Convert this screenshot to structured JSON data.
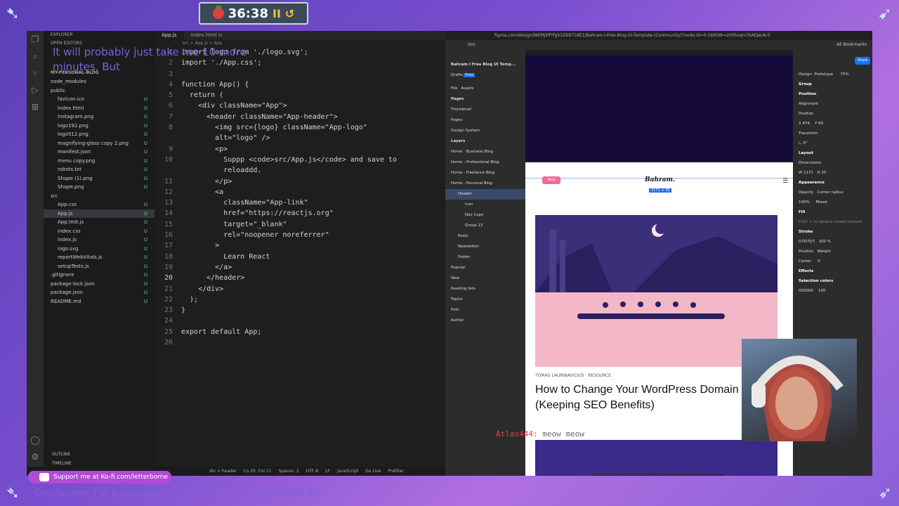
{
  "timer": {
    "time": "36:38",
    "pause": "II",
    "reset": "↺"
  },
  "overlay_text": "It will probably just take me 10 more minutes. But",
  "vscode": {
    "explorer_title": "EXPLORER",
    "open_editors": "OPEN EDITORS",
    "project": "MY-PERSONAL-BLOG",
    "tree": [
      {
        "label": "node_modules",
        "indent": 1,
        "badge": ""
      },
      {
        "label": "public",
        "indent": 1,
        "badge": ""
      },
      {
        "label": "favicon.ico",
        "indent": 2,
        "badge": "U"
      },
      {
        "label": "index.html",
        "indent": 2,
        "badge": "U"
      },
      {
        "label": "Instagram.png",
        "indent": 2,
        "badge": "U"
      },
      {
        "label": "logo192.png",
        "indent": 2,
        "badge": "U"
      },
      {
        "label": "logo512.png",
        "indent": 2,
        "badge": "U"
      },
      {
        "label": "magnifying-glass copy 2.png",
        "indent": 2,
        "badge": "U"
      },
      {
        "label": "manifest.json",
        "indent": 2,
        "badge": "U"
      },
      {
        "label": "menu copy.png",
        "indent": 2,
        "badge": "U"
      },
      {
        "label": "robots.txt",
        "indent": 2,
        "badge": "U"
      },
      {
        "label": "Shape (1).png",
        "indent": 2,
        "badge": "U"
      },
      {
        "label": "Shape.png",
        "indent": 2,
        "badge": "U"
      },
      {
        "label": "src",
        "indent": 1,
        "badge": ""
      },
      {
        "label": "App.css",
        "indent": 2,
        "badge": "U"
      },
      {
        "label": "App.js",
        "indent": 2,
        "badge": "U"
      },
      {
        "label": "App.test.js",
        "indent": 2,
        "badge": "U"
      },
      {
        "label": "index.css",
        "indent": 2,
        "badge": "U"
      },
      {
        "label": "index.js",
        "indent": 2,
        "badge": "U"
      },
      {
        "label": "logo.svg",
        "indent": 2,
        "badge": "U"
      },
      {
        "label": "reportWebVitals.js",
        "indent": 2,
        "badge": "U"
      },
      {
        "label": "setupTests.js",
        "indent": 2,
        "badge": "U"
      },
      {
        "label": ".gitignore",
        "indent": 1,
        "badge": "U"
      },
      {
        "label": "package-lock.json",
        "indent": 1,
        "badge": "U"
      },
      {
        "label": "package.json",
        "indent": 1,
        "badge": "U"
      },
      {
        "label": "README.md",
        "indent": 1,
        "badge": "U"
      }
    ],
    "outline": "OUTLINE",
    "timeline": "TIMELINE",
    "tabs": [
      "App.js",
      "index.html U"
    ],
    "breadcrumb": "src > App.js > App",
    "code": [
      {
        "n": "1",
        "t": "import logo from './logo.svg';"
      },
      {
        "n": "2",
        "t": "import './App.css';"
      },
      {
        "n": "3",
        "t": ""
      },
      {
        "n": "4",
        "t": "function App() {"
      },
      {
        "n": "5",
        "t": "  return ("
      },
      {
        "n": "6",
        "t": "    <div className=\"App\">"
      },
      {
        "n": "7",
        "t": "      <header className=\"App-header\">"
      },
      {
        "n": "8",
        "t": "        <img src={logo} className=\"App-logo\""
      },
      {
        "n": "",
        "t": "        alt=\"logo\" />"
      },
      {
        "n": "9",
        "t": "        <p>"
      },
      {
        "n": "10",
        "t": "          Suppp <code>src/App.js</code> and save to"
      },
      {
        "n": "",
        "t": "          reloaddd."
      },
      {
        "n": "11",
        "t": "        </p>"
      },
      {
        "n": "12",
        "t": "        <a"
      },
      {
        "n": "13",
        "t": "          className=\"App-link\""
      },
      {
        "n": "14",
        "t": "          href=\"https://reactjs.org\""
      },
      {
        "n": "15",
        "t": "          target=\"_blank\""
      },
      {
        "n": "16",
        "t": "          rel=\"noopener noreferrer\""
      },
      {
        "n": "17",
        "t": "        >"
      },
      {
        "n": "18",
        "t": "          Learn React"
      },
      {
        "n": "19",
        "t": "        </a>"
      },
      {
        "n": "20",
        "t": "      </header>"
      },
      {
        "n": "21",
        "t": "    </div>"
      },
      {
        "n": "22",
        "t": "  );"
      },
      {
        "n": "23",
        "t": "}"
      },
      {
        "n": "24",
        "t": ""
      },
      {
        "n": "25",
        "t": "export default App;"
      },
      {
        "n": "26",
        "t": ""
      }
    ],
    "status": [
      "div > header",
      "Ln 20, Col 11",
      "Spaces: 2",
      "UTF-8",
      "LF",
      "JavaScript",
      "Go Live",
      "Prettier"
    ]
  },
  "browser": {
    "url": "figma.com/design/WEMjl0fYfgV2Z68716E1/Bahram-I-Free-Blog-UI-Template-(Community)?node-id=0-16658t=zHShsqm7kAEJecN-0",
    "bookmark": "Uni",
    "all_bookmarks": "All Bookmarks",
    "file_title": "Bahram I Free Blog UI Temp...",
    "drafts": "Drafts",
    "free": "Free",
    "file_tab": "File",
    "assets_tab": "Assets",
    "pages_label": "Pages",
    "pages": [
      "Thumbnail",
      "Pages",
      "Design System"
    ],
    "layers_label": "Layers",
    "layers": [
      {
        "label": "Home - Business Blog",
        "indent": 0
      },
      {
        "label": "Home - Professional Blog",
        "indent": 0
      },
      {
        "label": "Home - Freelance Blog",
        "indent": 0
      },
      {
        "label": "Home - Personal Blog",
        "indent": 0
      },
      {
        "label": "Header",
        "indent": 1
      },
      {
        "label": "Icon",
        "indent": 2
      },
      {
        "label": "Nav Copy",
        "indent": 2
      },
      {
        "label": "Group 13",
        "indent": 2
      },
      {
        "label": "Posts",
        "indent": 1
      },
      {
        "label": "Newsletter",
        "indent": 1
      },
      {
        "label": "Footer",
        "indent": 1
      },
      {
        "label": "Popular",
        "indent": 0
      },
      {
        "label": "New",
        "indent": 0
      },
      {
        "label": "Reading lists",
        "indent": 0
      },
      {
        "label": "Topics",
        "indent": 0
      },
      {
        "label": "Post",
        "indent": 0
      },
      {
        "label": "Author",
        "indent": 0
      }
    ],
    "canvas": {
      "logo": "Bahram.",
      "new_btn": "New",
      "dims": "1171 × 35",
      "meta": "TOMAS LAURINAVICIUS   ·   RESOURCE",
      "headline": "How to Change Your WordPress Domain (Keeping SEO Benefits)"
    },
    "props": {
      "share": "Share",
      "design_tab": "Design",
      "prototype_tab": "Prototype",
      "zoom": "75%",
      "group": "Group",
      "position": "Position",
      "alignment": "Alignment",
      "pos_label": "Position",
      "x": "X  474",
      "y": "Y  60",
      "transform": "Transform",
      "rot": "∟  0°",
      "layout": "Layout",
      "dimensions": "Dimensions",
      "w": "W  1171",
      "h": "H  35",
      "appearance": "Appearance",
      "opacity": "Opacity",
      "corner": "Corner radius",
      "opacity_val": "100%",
      "corner_val": "Mixed",
      "fill": "Fill",
      "fill_hint": "Click + to replace mixed content",
      "stroke": "Stroke",
      "stroke_hex": "D7D7D7",
      "stroke_pct": "100 %",
      "position2": "Position",
      "weight": "Weight",
      "center": "Center",
      "weight_val": "0",
      "effects": "Effects",
      "selection_colors": "Selection colors",
      "sel_color": "000000",
      "sel_pct": "100"
    },
    "toolbar": [
      "▷",
      "#",
      "□",
      "✎",
      "T",
      "○",
      "⁂",
      "</>"
    ]
  },
  "chat": {
    "user": "Atlas444:",
    "message": "meow meow"
  },
  "kofi": "Support me at Ko-fi.com/letterborne",
  "disclaimer": "Disclaimer: I'm a programming beginner so be warned xD",
  "colors": {
    "accent": "#7f62d6",
    "figma_blue": "#1e6fff",
    "kofi": "#b24ad6"
  }
}
